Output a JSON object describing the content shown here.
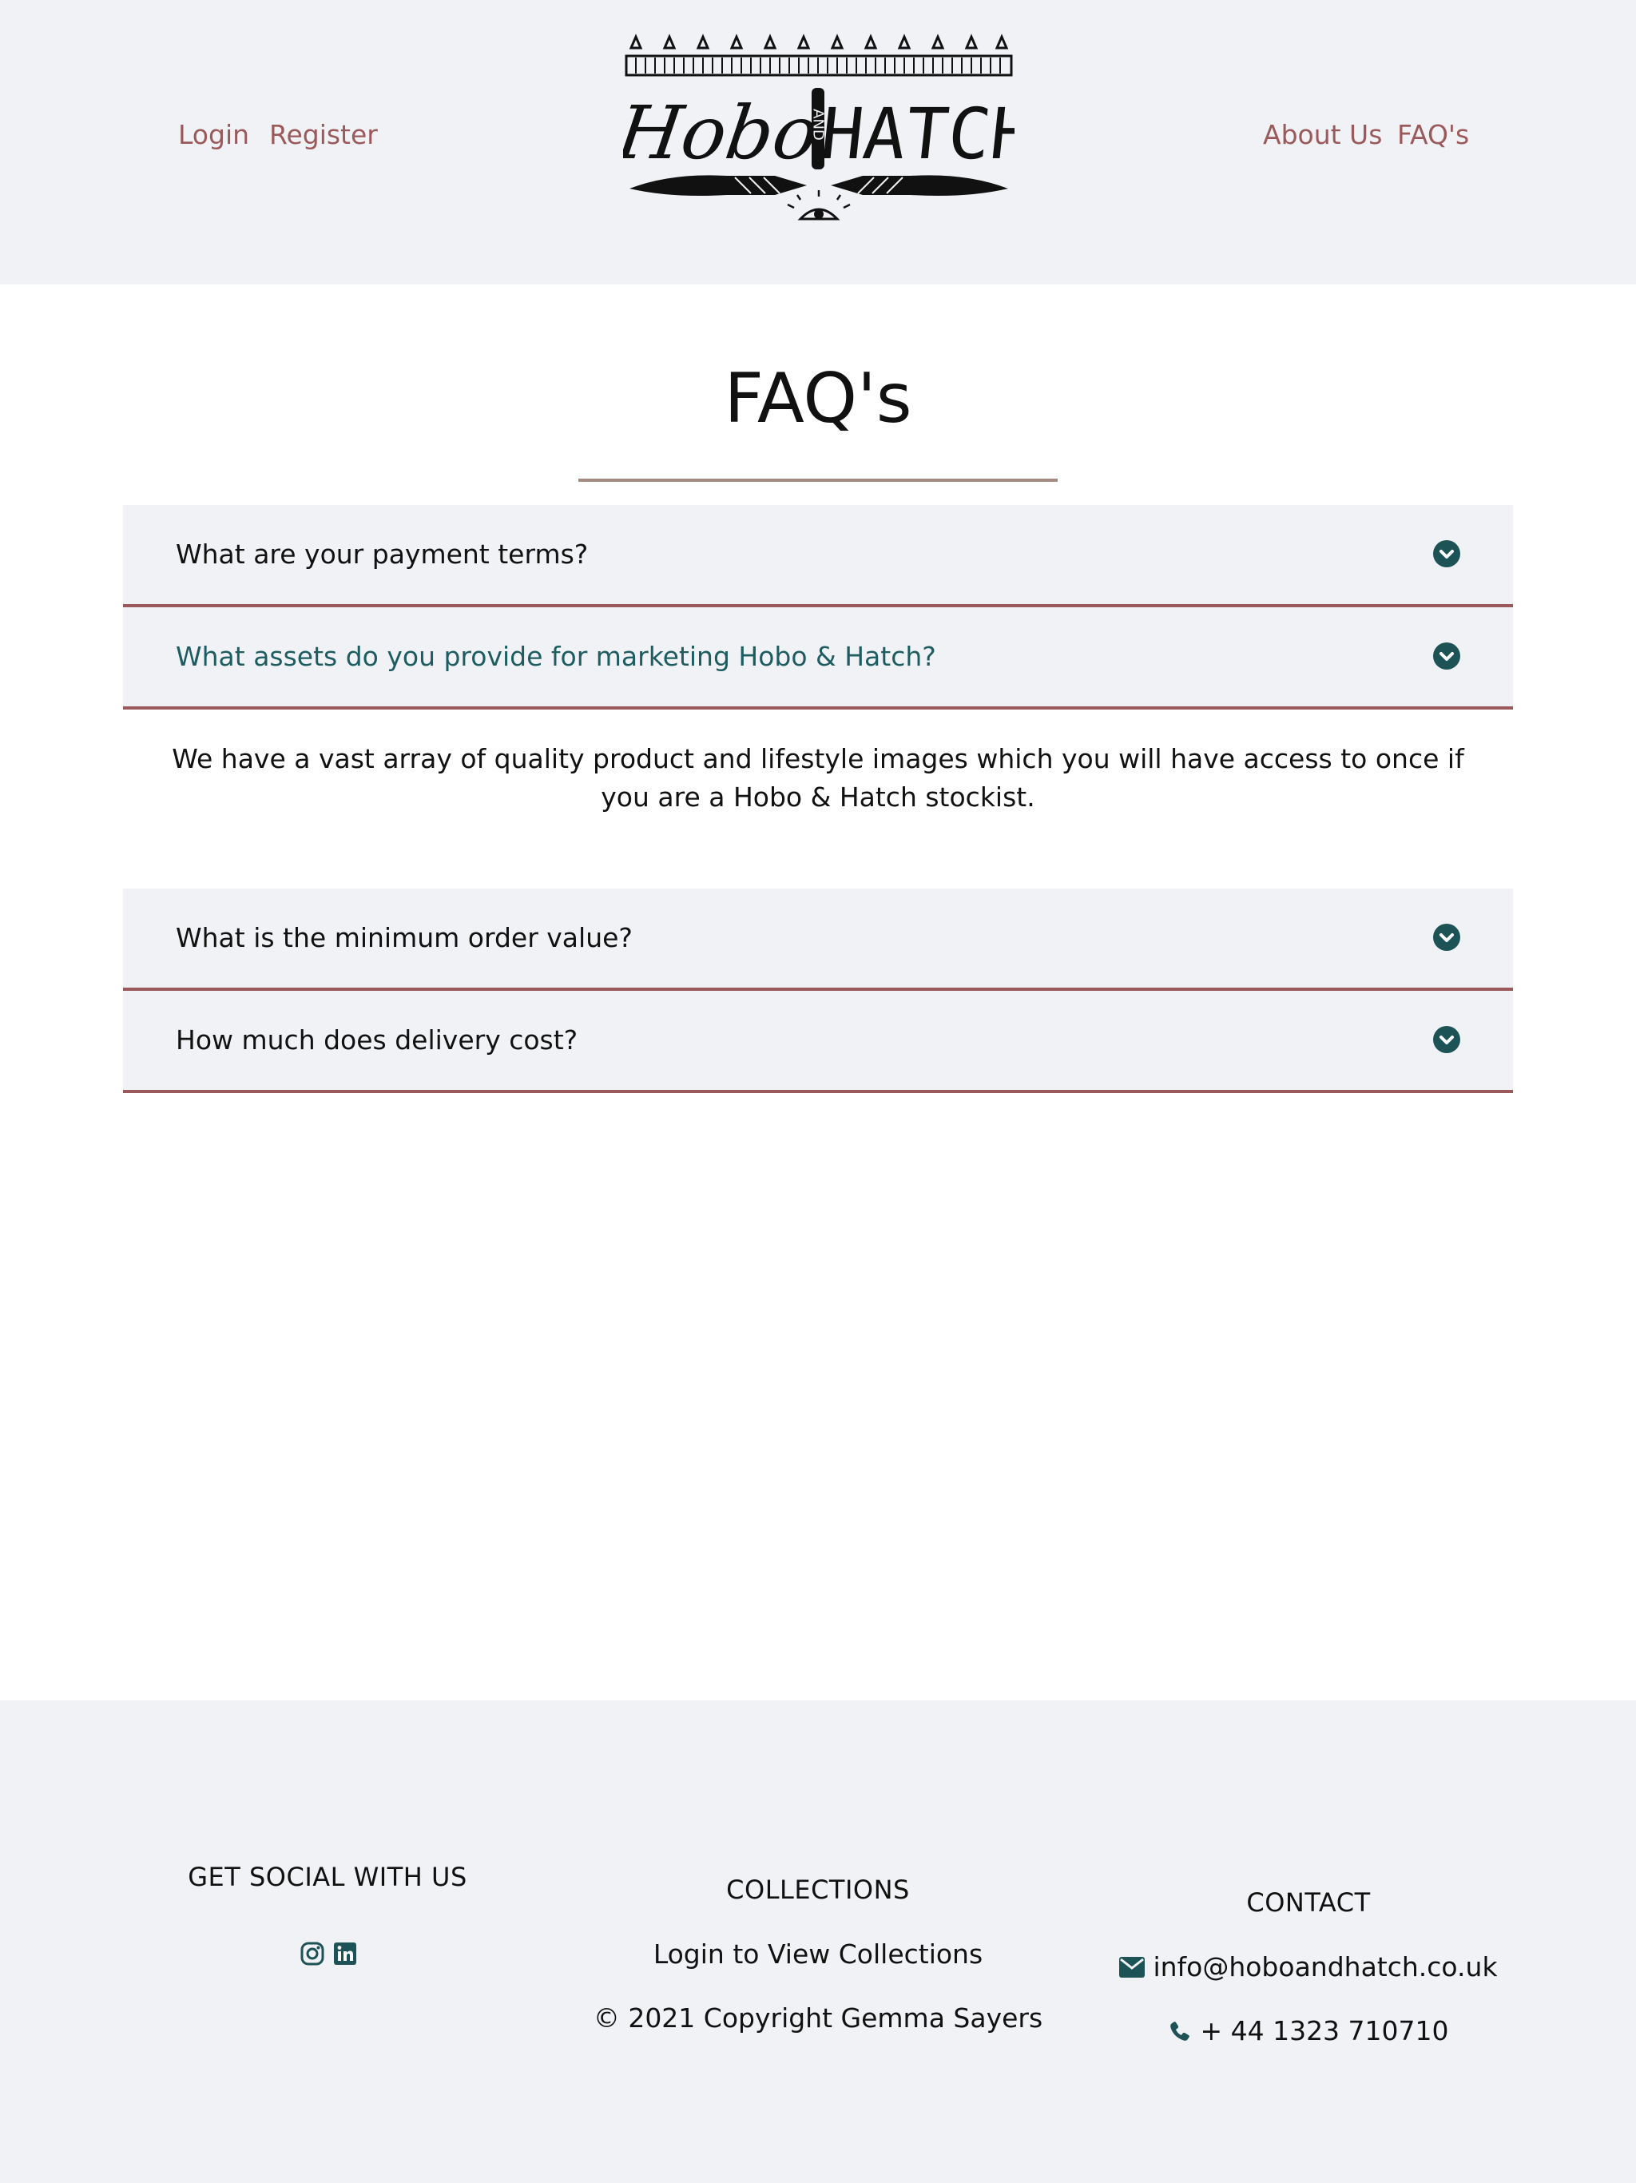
{
  "header": {
    "nav_left": [
      "Login",
      "Register"
    ],
    "nav_right": [
      "About Us",
      "FAQ's"
    ],
    "logo": {
      "word_left": "Hobo",
      "word_and": "AND",
      "word_right": "HATCH",
      "alt": "Hobo and Hatch logo"
    }
  },
  "main": {
    "title": "FAQ's",
    "faqs": [
      {
        "question": "What are your payment terms?",
        "open": false
      },
      {
        "question": "What assets do you provide for marketing Hobo & Hatch?",
        "open": true,
        "answer": "We have a vast array of quality product and lifestyle images which you will have access to once if you are a Hobo & Hatch stockist."
      },
      {
        "question": "What is the minimum order value?",
        "open": false
      },
      {
        "question": "How much does delivery cost?",
        "open": false
      }
    ]
  },
  "footer": {
    "social": {
      "heading": "GET SOCIAL WITH US",
      "icons": [
        "instagram-icon",
        "linkedin-icon"
      ]
    },
    "collections": {
      "heading": "COLLECTIONS",
      "link": "Login to View Collections",
      "copyright": "© 2021 Copyright Gemma Sayers"
    },
    "contact": {
      "heading": "CONTACT",
      "email": "info@hoboandhatch.co.uk",
      "phone": "+ 44 1323 710710"
    }
  },
  "colors": {
    "accent_teal": "#1d5257",
    "link_rose": "#9a5a5c",
    "panel_bg": "#f1f2f5",
    "rule_tan": "#a38b7f"
  }
}
